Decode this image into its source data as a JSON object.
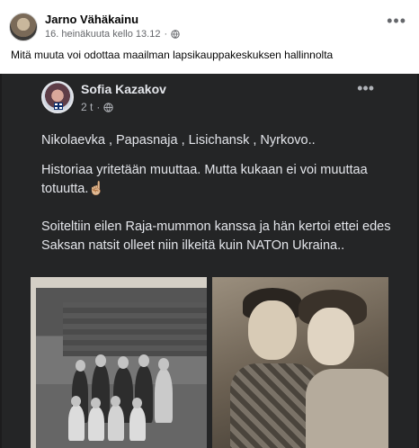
{
  "outer_post": {
    "author": "Jarno Vähäkainu",
    "timestamp": "16. heinäkuuta kello 13.12",
    "separator": "·",
    "privacy_icon": "globe-icon",
    "more_options": "•••",
    "text": "Mitä muuta voi odottaa maailman lapsikauppakeskuksen  hallinnolta"
  },
  "shared_post": {
    "author": "Sofia Kazakov",
    "time": "2 t",
    "separator": "·",
    "privacy_icon": "globe-icon",
    "more_options": "•••",
    "paragraphs": [
      "Nikolaevka , Papasnaja , Lisichansk , Nyrkovo..",
      "Historiaa yritetään muuttaa. Mutta kukaan ei voi muuttaa totuutta.☝🏼",
      "Soiteltiin eilen Raja-mummon kanssa ja hän kertoi ettei edes Saksan natsit olleet niin ilkeitä kuin NATOn Ukraina.."
    ]
  },
  "colors": {
    "shared_background": "#242526",
    "shared_text": "#e4e6eb",
    "meta_text": "#65676b"
  }
}
